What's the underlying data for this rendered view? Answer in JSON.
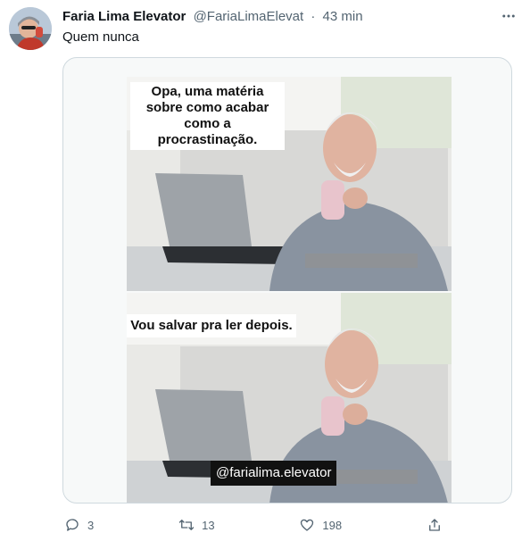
{
  "tweet": {
    "display_name": "Faria Lima Elevator",
    "handle": "@FariaLimaElevat",
    "separator": "·",
    "time": "43 min",
    "text": "Quem nunca"
  },
  "media": {
    "caption_top": "Opa, uma matéria sobre como acabar como a procrastinação.",
    "caption_bottom": "Vou salvar pra ler depois.",
    "watermark": "@farialima.elevator"
  },
  "actions": {
    "reply_count": "3",
    "retweet_count": "13",
    "like_count": "198"
  },
  "icons": [
    "more-icon",
    "reply-icon",
    "retweet-icon",
    "like-icon",
    "share-icon"
  ],
  "colors": {
    "muted": "#536471",
    "text": "#0f1419",
    "border": "#cfd9de"
  }
}
